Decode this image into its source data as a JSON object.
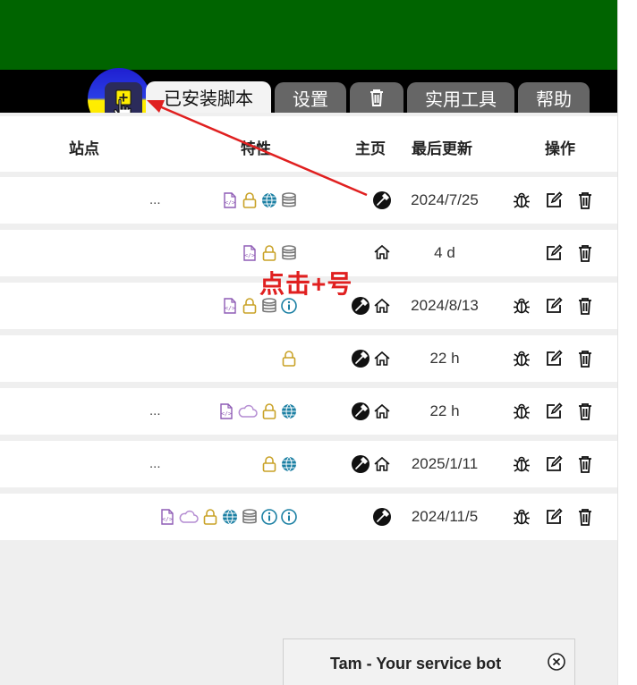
{
  "tabs": {
    "installed": "已安装脚本",
    "settings": "设置",
    "trash_icon": "trash-icon",
    "utilities": "实用工具",
    "help": "帮助"
  },
  "add_icon": "plus-square-icon",
  "table": {
    "headers": {
      "site": "站点",
      "features": "特性",
      "homepage": "主页",
      "updated": "最后更新",
      "actions": "操作"
    },
    "rows": [
      {
        "site": "...",
        "features": [
          "file-code",
          "lock",
          "globe",
          "database"
        ],
        "home": [
          "greasyfork"
        ],
        "updated": "2024/7/25",
        "actions": [
          "bug",
          "edit",
          "delete"
        ]
      },
      {
        "site": "",
        "features": [
          "file-code",
          "lock",
          "database"
        ],
        "home": [
          "home"
        ],
        "updated": "4 d",
        "actions": [
          "edit",
          "delete"
        ]
      },
      {
        "site": "",
        "features": [
          "file-code",
          "lock",
          "database",
          "info"
        ],
        "home": [
          "greasyfork",
          "home"
        ],
        "updated": "2024/8/13",
        "actions": [
          "bug",
          "edit",
          "delete"
        ]
      },
      {
        "site": "",
        "features": [
          "lock"
        ],
        "home": [
          "greasyfork",
          "home"
        ],
        "updated": "22 h",
        "actions": [
          "bug",
          "edit",
          "delete"
        ]
      },
      {
        "site": "...",
        "features": [
          "file-code",
          "cloud",
          "lock",
          "globe"
        ],
        "home": [
          "greasyfork",
          "home"
        ],
        "updated": "22 h",
        "actions": [
          "bug",
          "edit",
          "delete"
        ]
      },
      {
        "site": "...",
        "features": [
          "lock",
          "globe"
        ],
        "home": [
          "greasyfork",
          "home"
        ],
        "updated": "2025/1/11",
        "actions": [
          "bug",
          "edit",
          "delete"
        ]
      },
      {
        "site": "",
        "features": [
          "file-code",
          "cloud",
          "lock",
          "globe",
          "database",
          "info",
          "info"
        ],
        "home": [
          "greasyfork"
        ],
        "updated": "2024/11/5",
        "actions": [
          "bug",
          "edit",
          "delete"
        ]
      }
    ]
  },
  "annotation": "点击+号",
  "chat": {
    "title": "Tam - Your service bot",
    "close_icon": "close-circle-icon"
  },
  "colors": {
    "header_green": "#006400",
    "tab_gray": "#666666",
    "annotation_red": "#e02020",
    "feature_purple": "#8e5bb5",
    "feature_gold": "#c9a227",
    "feature_teal": "#1a7fa3"
  }
}
